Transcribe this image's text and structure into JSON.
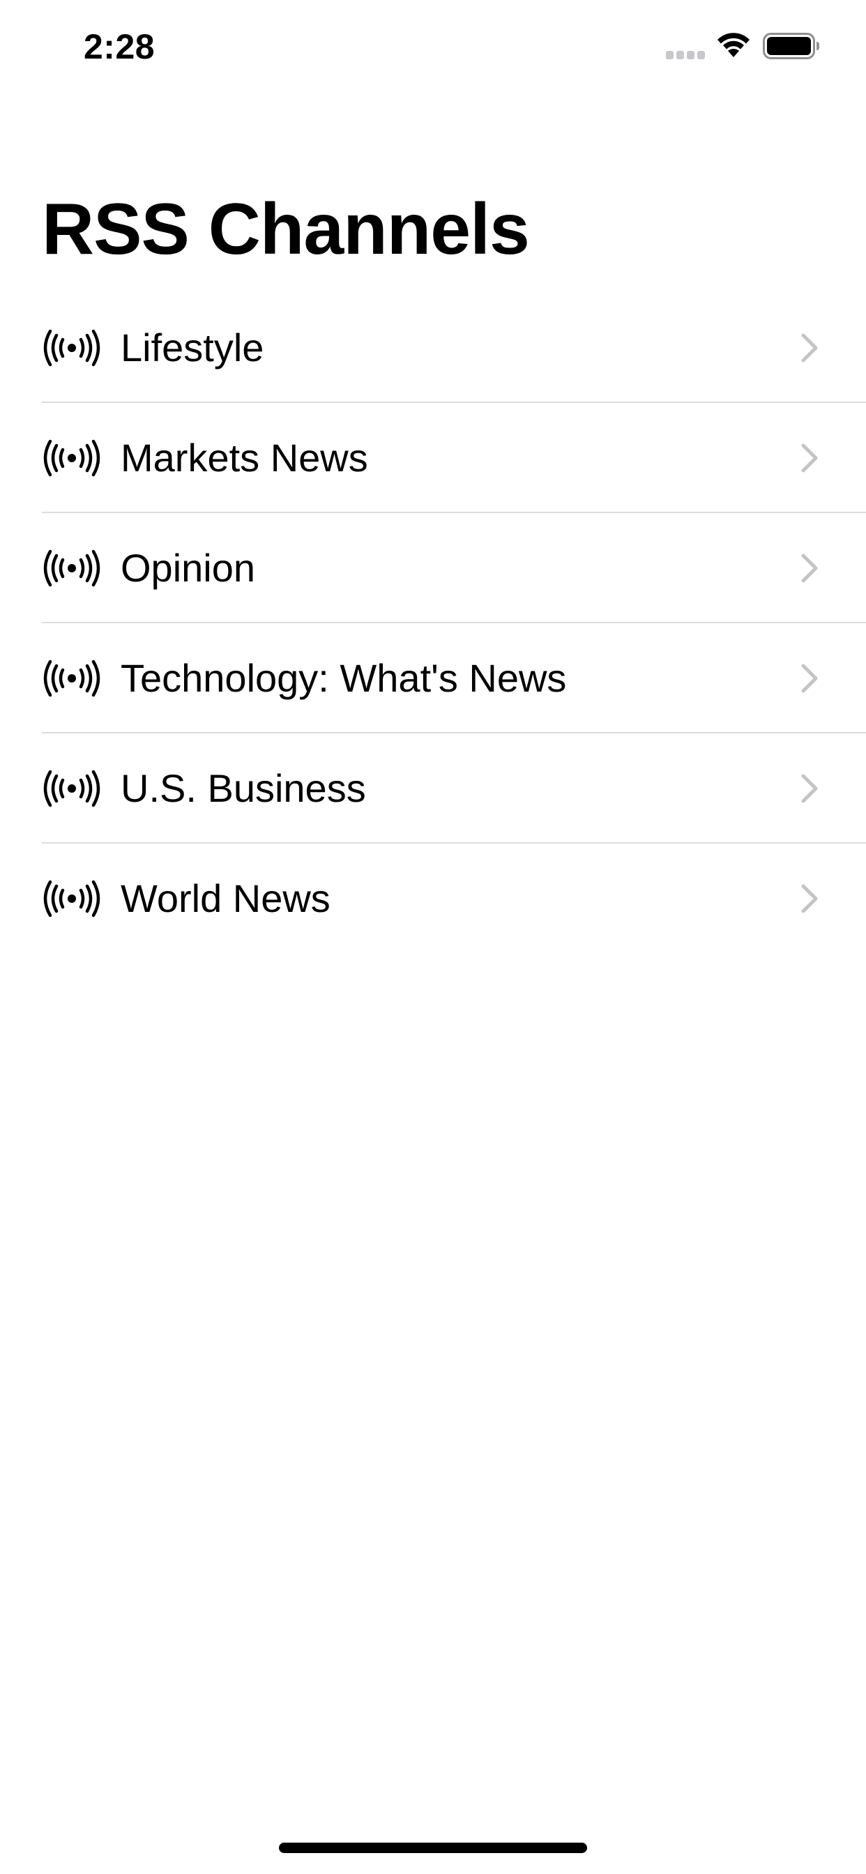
{
  "status_bar": {
    "time": "2:28",
    "icons": [
      "cellular-signal-icon",
      "wifi-icon",
      "battery-icon"
    ]
  },
  "nav": {
    "title": "RSS Channels"
  },
  "channels": [
    {
      "label": "Lifestyle",
      "icon": "broadcast-icon"
    },
    {
      "label": "Markets News",
      "icon": "broadcast-icon"
    },
    {
      "label": "Opinion",
      "icon": "broadcast-icon"
    },
    {
      "label": "Technology: What's News",
      "icon": "broadcast-icon"
    },
    {
      "label": "U.S. Business",
      "icon": "broadcast-icon"
    },
    {
      "label": "World News",
      "icon": "broadcast-icon"
    }
  ],
  "colors": {
    "text": "#000000",
    "chevron": "#c4c4c7",
    "divider": "#dcdcdf",
    "signal_inactive": "#c7c7cc",
    "background": "#ffffff"
  }
}
